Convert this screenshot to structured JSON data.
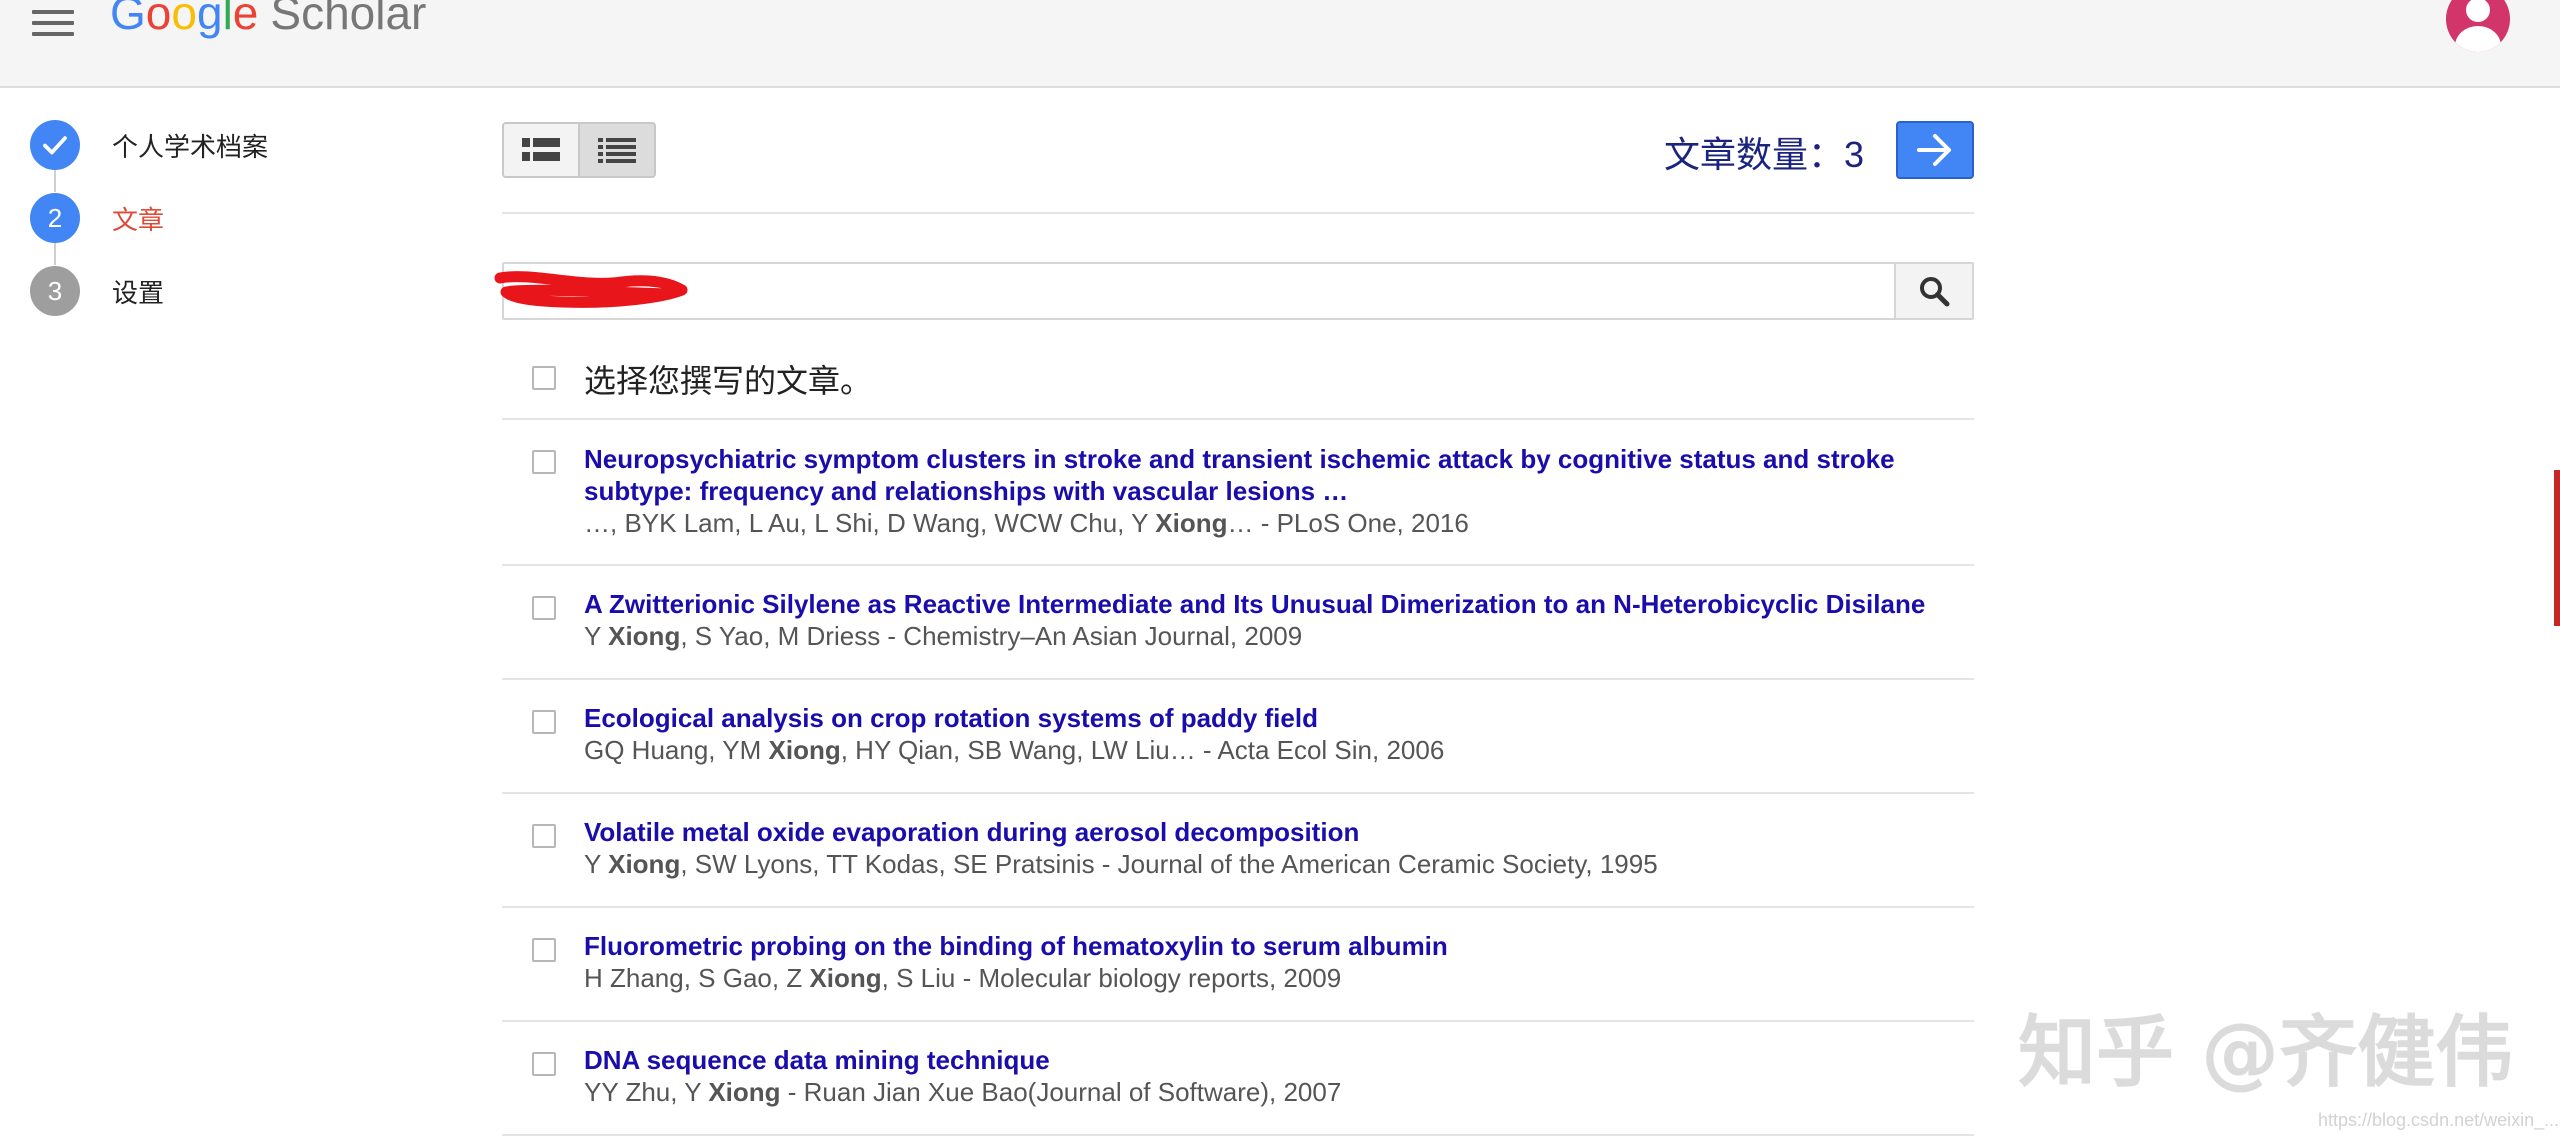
{
  "header": {
    "logo_text": "Google Scholar",
    "menu_icon": "hamburger-menu-icon",
    "avatar_icon": "user-avatar-icon"
  },
  "stepper": {
    "steps": [
      {
        "number": "✓",
        "label": "个人学术档案",
        "state": "done",
        "color": "#4285f4"
      },
      {
        "number": "2",
        "label": "文章",
        "state": "active",
        "color": "#4285f4"
      },
      {
        "number": "3",
        "label": "设置",
        "state": "pending",
        "color": "#9e9e9e"
      }
    ]
  },
  "toolbar": {
    "view_buttons": [
      "detailed-list-icon",
      "compact-list-icon"
    ],
    "active_view": 1,
    "article_count_label": "文章数量：",
    "article_count": "3",
    "next_icon": "arrow-right-icon"
  },
  "search": {
    "value": "",
    "value_redacted": true,
    "icon": "search-icon"
  },
  "select_all_label": "选择您撰写的文章。",
  "articles": [
    {
      "title": "Neuropsychiatric symptom clusters in stroke and transient ischemic attack by cognitive status and stroke subtype: frequency and relationships with vascular lesions …",
      "authors_before": "…, BYK Lam, L Au, L Shi, D Wang, WCW Chu, Y ",
      "author_bold": "Xiong",
      "authors_after": "… - PLoS One, 2016"
    },
    {
      "title": "A Zwitterionic Silylene as Reactive Intermediate and Its Unusual Dimerization to an N-Heterobicyclic Disilane",
      "authors_before": "Y ",
      "author_bold": "Xiong",
      "authors_after": ", S Yao, M Driess - Chemistry–An Asian Journal, 2009"
    },
    {
      "title": "Ecological analysis on crop rotation systems of paddy field",
      "authors_before": "GQ Huang, YM ",
      "author_bold": "Xiong",
      "authors_after": ", HY Qian, SB Wang, LW Liu… - Acta Ecol Sin, 2006"
    },
    {
      "title": "Volatile metal oxide evaporation during aerosol decomposition",
      "authors_before": "Y ",
      "author_bold": "Xiong",
      "authors_after": ", SW Lyons, TT Kodas, SE Pratsinis - Journal of the American Ceramic Society, 1995"
    },
    {
      "title": "Fluorometric probing on the binding of hematoxylin to serum albumin",
      "authors_before": "H Zhang, S Gao, Z ",
      "author_bold": "Xiong",
      "authors_after": ", S Liu - Molecular biology reports, 2009"
    },
    {
      "title": "DNA sequence data mining technique",
      "authors_before": "YY Zhu, Y ",
      "author_bold": "Xiong",
      "authors_after": " - Ruan Jian Xue Bao(Journal of Software), 2007"
    }
  ],
  "watermark": {
    "text": "知乎 @齐健伟",
    "small": "https://blog.csdn.net/weixin_..."
  },
  "colors": {
    "accent": "#4285f4",
    "title_link": "#1a0dab",
    "active_step_text": "#dd4b39",
    "count_text": "#1a237e"
  }
}
